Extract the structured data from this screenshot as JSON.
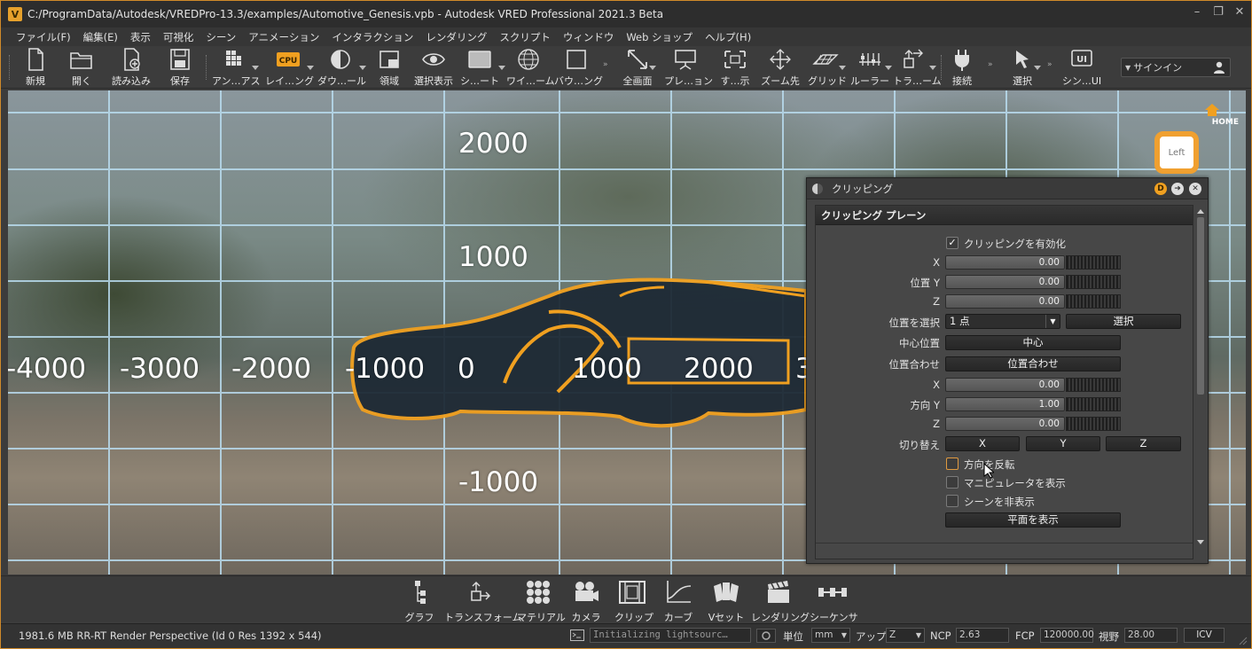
{
  "window": {
    "title": "C:/ProgramData/Autodesk/VREDPro-13.3/examples/Automotive_Genesis.vpb - Autodesk VRED Professional 2021.3 Beta",
    "logo": "V"
  },
  "menu": [
    "ファイル(F)",
    "編集(E)",
    "表示",
    "可視化",
    "シーン",
    "アニメーション",
    "インタラクション",
    "レンダリング",
    "スクリプト",
    "ウィンドウ",
    "Web ショップ",
    "ヘルプ(H)"
  ],
  "toolbar": {
    "new": "新規",
    "open": "開く",
    "import": "読み込み",
    "save": "保存",
    "antialias": "アン…アス",
    "raytracing": "レイ…ング",
    "download": "ダウ…ール",
    "region": "領域",
    "show_selected": "選択表示",
    "shaded": "シ…ート",
    "wireframe": "ワイ…ーム",
    "bounding": "バウ…ング",
    "fullscreen": "全画面",
    "presentation": "プレ…ョン",
    "show_all": "す…示",
    "zoom_to": "ズーム先",
    "grid": "グリッド",
    "ruler": "ルーラー",
    "transform": "トラ…ーム",
    "connect": "接続",
    "select": "選択",
    "scene_ui": "シン…UI",
    "cpu_badge": "CPU",
    "ui_badge": "UI",
    "signin": "サインイン"
  },
  "viewport": {
    "axis_labels_x": [
      "-4000",
      "-3000",
      "-2000",
      "-1000",
      "0",
      "1000",
      "2000",
      "3"
    ],
    "axis_labels_y": [
      "2000",
      "1000",
      "-1000"
    ],
    "navcube": {
      "home": "HOME",
      "face": "Left"
    },
    "accent_color": "#f0a020"
  },
  "clip_panel": {
    "title": "クリッピング",
    "section": "クリッピング プレーン",
    "enable_label": "クリッピングを有効化",
    "enable_checked": true,
    "pos_label": "位置",
    "pos_x": "0.00",
    "pos_y": "0.00",
    "pos_z": "0.00",
    "select_pos_label": "位置を選択",
    "select_pos_value": "1 点",
    "select_btn": "選択",
    "center_label": "中心位置",
    "center_btn": "中心",
    "align_label": "位置合わせ",
    "align_btn": "位置合わせ",
    "dir_label": "方向",
    "dir_x": "0.00",
    "dir_y": "1.00",
    "dir_z": "0.00",
    "toggle_label": "切り替え",
    "toggle_x": "X",
    "toggle_y": "Y",
    "toggle_z": "Z",
    "axis_x": "X",
    "axis_y": "Y",
    "axis_z": "Z",
    "flip_label": "方向を反転",
    "show_manip_label": "マニピュレータを表示",
    "hide_scene_label": "シーンを非表示",
    "show_plane_btn": "平面を表示"
  },
  "bottom_tools": [
    "グラフ",
    "トランスフォーム",
    "マテリアル",
    "カメラ",
    "クリップ",
    "カーブ",
    "Vセット",
    "レンダリング",
    "シーケンサ"
  ],
  "status": {
    "info": "1981.6 MB  RR-RT  Render Perspective (Id 0 Res 1392 x 544)",
    "console": "Initializing lightsourc…",
    "unit_label": "単位",
    "unit_value": "mm",
    "up_label": "アップ",
    "up_value": "Z",
    "ncp_label": "NCP",
    "ncp_value": "2.63",
    "fcp_label": "FCP",
    "fcp_value": "120000.00",
    "fov_label": "視野",
    "fov_value": "28.00",
    "icv": "ICV"
  }
}
